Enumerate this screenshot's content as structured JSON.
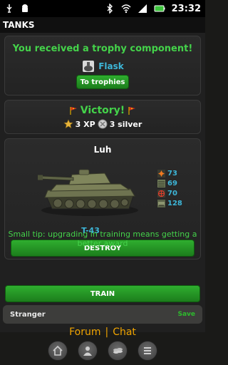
{
  "status_bar": {
    "time": "23:32",
    "icons": [
      "usb-icon",
      "android-debug-icon",
      "bluetooth-icon",
      "wifi-icon",
      "signal-icon",
      "battery-icon"
    ]
  },
  "app": {
    "title": "TANKS"
  },
  "trophy": {
    "heading": "You received a trophy component!",
    "item_name": "Flask",
    "button_label": "To trophies"
  },
  "battle": {
    "result": "Victory!",
    "xp_text": "3 XP",
    "silver_text": "3 silver"
  },
  "tank": {
    "crew_name": "Luh",
    "model": "T-43",
    "stats": [
      {
        "icon": "firepower-icon",
        "value": "73"
      },
      {
        "icon": "armor-icon",
        "value": "69"
      },
      {
        "icon": "targeting-icon",
        "value": "70"
      },
      {
        "icon": "mobility-icon",
        "value": "128"
      }
    ],
    "destroy_label": "DESTROY"
  },
  "tip": {
    "text": "Small tip: upgrading in training means getting a better award"
  },
  "train": {
    "label": "TRAIN"
  },
  "opponent": {
    "name": "Stranger",
    "save_label": "Save"
  },
  "links": {
    "forum": "Forum",
    "separator": "|",
    "chat": "Chat"
  },
  "nav": [
    "home-icon",
    "profile-icon",
    "coins-icon",
    "menu-icon"
  ],
  "colors": {
    "accent_green": "#44d34a",
    "accent_blue": "#3db6d8",
    "link_orange": "#f0a400"
  }
}
